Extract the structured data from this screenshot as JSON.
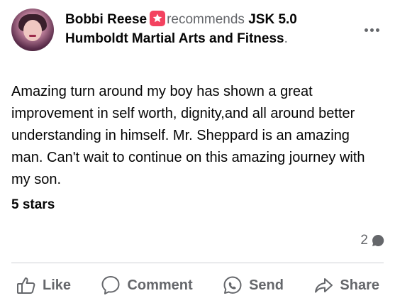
{
  "post": {
    "author": "Bobbi Reese",
    "verb": "recommends",
    "page": "JSK 5.0 Humboldt Martial Arts and Fitness",
    "page_suffix": ".",
    "review_text": "Amazing turn around my boy has shown a great improvement in self worth, dignity,and all around better understanding in himself. Mr. Sheppard is an amazing man. Can't wait to continue on this amazing journey with my son.",
    "rating_label": "5 stars",
    "comment_count": "2"
  },
  "icons": {
    "recommend": "recommend-badge-icon",
    "more": "more-options-icon",
    "comment_bubble": "comment-bubble-icon",
    "like": "thumbs-up-icon",
    "comment": "comment-icon",
    "send": "send-icon",
    "share": "share-icon"
  },
  "actions": {
    "like": "Like",
    "comment": "Comment",
    "send": "Send",
    "share": "Share"
  },
  "colors": {
    "recommend_badge": "#f3425f",
    "secondary_text": "#65676b",
    "primary_text": "#050505"
  }
}
